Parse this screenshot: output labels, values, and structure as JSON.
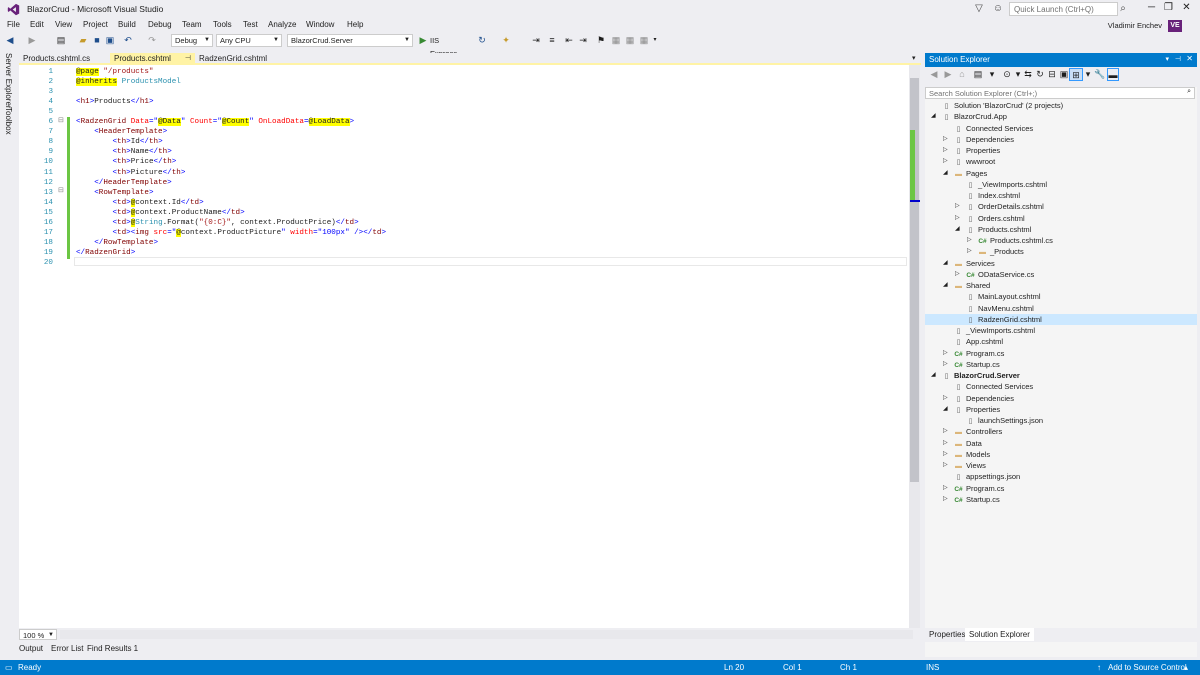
{
  "window": {
    "title": "BlazorCrud - Microsoft Visual Studio",
    "quick_launch_placeholder": "Quick Launch (Ctrl+Q)",
    "user_name": "Vladimir Enchev",
    "user_initials": "VE"
  },
  "menu": [
    "File",
    "Edit",
    "View",
    "Project",
    "Build",
    "Debug",
    "Team",
    "Tools",
    "Test",
    "Analyze",
    "Window",
    "Help"
  ],
  "toolbar": {
    "configuration": "Debug",
    "platform": "Any CPU",
    "startup_project": "BlazorCrud.Server",
    "run_target": "IIS Express"
  },
  "side_strip": [
    "Server Explorer",
    "Toolbox"
  ],
  "doc_tabs": [
    "Products.cshtml.cs",
    "Products.cshtml",
    "RadzenGrid.cshtml"
  ],
  "editor": {
    "zoom": "100 %",
    "lines": [
      [
        {
          "c": "r",
          "t": "@page"
        },
        {
          "c": "n",
          "t": " "
        },
        {
          "c": "s",
          "t": "\"/products\""
        }
      ],
      [
        {
          "c": "r",
          "t": "@inherits"
        },
        {
          "c": "n",
          "t": " "
        },
        {
          "c": "c",
          "t": "ProductsModel"
        }
      ],
      [],
      [
        {
          "c": "k",
          "t": "<"
        },
        {
          "c": "t",
          "t": "h1"
        },
        {
          "c": "k",
          "t": ">"
        },
        {
          "c": "n",
          "t": "Products"
        },
        {
          "c": "k",
          "t": "</"
        },
        {
          "c": "t",
          "t": "h1"
        },
        {
          "c": "k",
          "t": ">"
        }
      ],
      [],
      [
        {
          "c": "k",
          "t": "<"
        },
        {
          "c": "t",
          "t": "RadzenGrid"
        },
        {
          "c": "n",
          "t": " "
        },
        {
          "c": "a",
          "t": "Data"
        },
        {
          "c": "k",
          "t": "=\""
        },
        {
          "c": "r",
          "t": "@Data"
        },
        {
          "c": "k",
          "t": "\""
        },
        {
          "c": "n",
          "t": " "
        },
        {
          "c": "a",
          "t": "Count"
        },
        {
          "c": "k",
          "t": "=\""
        },
        {
          "c": "r",
          "t": "@Count"
        },
        {
          "c": "k",
          "t": "\""
        },
        {
          "c": "n",
          "t": " "
        },
        {
          "c": "a",
          "t": "OnLoadData"
        },
        {
          "c": "k",
          "t": "="
        },
        {
          "c": "r",
          "t": "@LoadData"
        },
        {
          "c": "k",
          "t": ">"
        }
      ],
      [
        {
          "c": "n",
          "t": "    "
        },
        {
          "c": "k",
          "t": "<"
        },
        {
          "c": "t",
          "t": "HeaderTemplate"
        },
        {
          "c": "k",
          "t": ">"
        }
      ],
      [
        {
          "c": "n",
          "t": "        "
        },
        {
          "c": "k",
          "t": "<"
        },
        {
          "c": "t",
          "t": "th"
        },
        {
          "c": "k",
          "t": ">"
        },
        {
          "c": "n",
          "t": "Id"
        },
        {
          "c": "k",
          "t": "</"
        },
        {
          "c": "t",
          "t": "th"
        },
        {
          "c": "k",
          "t": ">"
        }
      ],
      [
        {
          "c": "n",
          "t": "        "
        },
        {
          "c": "k",
          "t": "<"
        },
        {
          "c": "t",
          "t": "th"
        },
        {
          "c": "k",
          "t": ">"
        },
        {
          "c": "n",
          "t": "Name"
        },
        {
          "c": "k",
          "t": "</"
        },
        {
          "c": "t",
          "t": "th"
        },
        {
          "c": "k",
          "t": ">"
        }
      ],
      [
        {
          "c": "n",
          "t": "        "
        },
        {
          "c": "k",
          "t": "<"
        },
        {
          "c": "t",
          "t": "th"
        },
        {
          "c": "k",
          "t": ">"
        },
        {
          "c": "n",
          "t": "Price"
        },
        {
          "c": "k",
          "t": "</"
        },
        {
          "c": "t",
          "t": "th"
        },
        {
          "c": "k",
          "t": ">"
        }
      ],
      [
        {
          "c": "n",
          "t": "        "
        },
        {
          "c": "k",
          "t": "<"
        },
        {
          "c": "t",
          "t": "th"
        },
        {
          "c": "k",
          "t": ">"
        },
        {
          "c": "n",
          "t": "Picture"
        },
        {
          "c": "k",
          "t": "</"
        },
        {
          "c": "t",
          "t": "th"
        },
        {
          "c": "k",
          "t": ">"
        }
      ],
      [
        {
          "c": "n",
          "t": "    "
        },
        {
          "c": "k",
          "t": "</"
        },
        {
          "c": "t",
          "t": "HeaderTemplate"
        },
        {
          "c": "k",
          "t": ">"
        }
      ],
      [
        {
          "c": "n",
          "t": "    "
        },
        {
          "c": "k",
          "t": "<"
        },
        {
          "c": "t",
          "t": "RowTemplate"
        },
        {
          "c": "k",
          "t": ">"
        }
      ],
      [
        {
          "c": "n",
          "t": "        "
        },
        {
          "c": "k",
          "t": "<"
        },
        {
          "c": "t",
          "t": "td"
        },
        {
          "c": "k",
          "t": ">"
        },
        {
          "c": "r",
          "t": "@"
        },
        {
          "c": "n",
          "t": "context.Id"
        },
        {
          "c": "k",
          "t": "</"
        },
        {
          "c": "t",
          "t": "td"
        },
        {
          "c": "k",
          "t": ">"
        }
      ],
      [
        {
          "c": "n",
          "t": "        "
        },
        {
          "c": "k",
          "t": "<"
        },
        {
          "c": "t",
          "t": "td"
        },
        {
          "c": "k",
          "t": ">"
        },
        {
          "c": "r",
          "t": "@"
        },
        {
          "c": "n",
          "t": "context.ProductName"
        },
        {
          "c": "k",
          "t": "</"
        },
        {
          "c": "t",
          "t": "td"
        },
        {
          "c": "k",
          "t": ">"
        }
      ],
      [
        {
          "c": "n",
          "t": "        "
        },
        {
          "c": "k",
          "t": "<"
        },
        {
          "c": "t",
          "t": "td"
        },
        {
          "c": "k",
          "t": ">"
        },
        {
          "c": "r",
          "t": "@"
        },
        {
          "c": "c",
          "t": "String"
        },
        {
          "c": "n",
          "t": ".Format("
        },
        {
          "c": "s",
          "t": "\"{0:C}\""
        },
        {
          "c": "n",
          "t": ", context.ProductPrice)"
        },
        {
          "c": "k",
          "t": "</"
        },
        {
          "c": "t",
          "t": "td"
        },
        {
          "c": "k",
          "t": ">"
        }
      ],
      [
        {
          "c": "n",
          "t": "        "
        },
        {
          "c": "k",
          "t": "<"
        },
        {
          "c": "t",
          "t": "td"
        },
        {
          "c": "k",
          "t": "><"
        },
        {
          "c": "t",
          "t": "img"
        },
        {
          "c": "n",
          "t": " "
        },
        {
          "c": "a",
          "t": "src"
        },
        {
          "c": "k",
          "t": "=\""
        },
        {
          "c": "r",
          "t": "@"
        },
        {
          "c": "n",
          "t": "context.ProductPicture"
        },
        {
          "c": "k",
          "t": "\""
        },
        {
          "c": "n",
          "t": " "
        },
        {
          "c": "a",
          "t": "width"
        },
        {
          "c": "k",
          "t": "=\""
        },
        {
          "c": "k",
          "t": "100px"
        },
        {
          "c": "k",
          "t": "\" /></"
        },
        {
          "c": "t",
          "t": "td"
        },
        {
          "c": "k",
          "t": ">"
        }
      ],
      [
        {
          "c": "n",
          "t": "    "
        },
        {
          "c": "k",
          "t": "</"
        },
        {
          "c": "t",
          "t": "RowTemplate"
        },
        {
          "c": "k",
          "t": ">"
        }
      ],
      [
        {
          "c": "k",
          "t": "</"
        },
        {
          "c": "t",
          "t": "RadzenGrid"
        },
        {
          "c": "k",
          "t": ">"
        }
      ],
      []
    ]
  },
  "bottom_tabs": [
    "Output",
    "Error List",
    "Find Results 1"
  ],
  "status": {
    "state": "Ready",
    "line": "Ln 20",
    "col": "Col 1",
    "ch": "Ch 1",
    "mode": "INS",
    "source_control": "Add to Source Control"
  },
  "solution_explorer": {
    "title": "Solution Explorer",
    "search_placeholder": "Search Solution Explorer (Ctrl+;)",
    "bottom_tabs": [
      "Properties",
      "Solution Explorer"
    ],
    "nodes": [
      {
        "label": "Solution 'BlazorCrud' (2 projects)",
        "depth": 0,
        "arrow": "",
        "icon": "page"
      },
      {
        "label": "BlazorCrud.App",
        "depth": 0,
        "arrow": "open",
        "icon": "page"
      },
      {
        "label": "Connected Services",
        "depth": 1,
        "arrow": "",
        "icon": "page"
      },
      {
        "label": "Dependencies",
        "depth": 1,
        "arrow": "closed",
        "icon": "page"
      },
      {
        "label": "Properties",
        "depth": 1,
        "arrow": "closed",
        "icon": "page"
      },
      {
        "label": "wwwroot",
        "depth": 1,
        "arrow": "closed",
        "icon": "page"
      },
      {
        "label": "Pages",
        "depth": 1,
        "arrow": "open",
        "icon": "folder"
      },
      {
        "label": "_ViewImports.cshtml",
        "depth": 2,
        "arrow": "",
        "icon": "page"
      },
      {
        "label": "Index.cshtml",
        "depth": 2,
        "arrow": "",
        "icon": "page"
      },
      {
        "label": "OrderDetails.cshtml",
        "depth": 2,
        "arrow": "closed",
        "icon": "page"
      },
      {
        "label": "Orders.cshtml",
        "depth": 2,
        "arrow": "closed",
        "icon": "page"
      },
      {
        "label": "Products.cshtml",
        "depth": 2,
        "arrow": "open",
        "icon": "page"
      },
      {
        "label": "Products.cshtml.cs",
        "depth": 3,
        "arrow": "closed",
        "icon": "cs"
      },
      {
        "label": "_Products",
        "depth": 3,
        "arrow": "closed",
        "icon": "folder"
      },
      {
        "label": "Services",
        "depth": 1,
        "arrow": "open",
        "icon": "folder"
      },
      {
        "label": "ODataService.cs",
        "depth": 2,
        "arrow": "closed",
        "icon": "cs"
      },
      {
        "label": "Shared",
        "depth": 1,
        "arrow": "open",
        "icon": "folder"
      },
      {
        "label": "MainLayout.cshtml",
        "depth": 2,
        "arrow": "",
        "icon": "page"
      },
      {
        "label": "NavMenu.cshtml",
        "depth": 2,
        "arrow": "",
        "icon": "page"
      },
      {
        "label": "RadzenGrid.cshtml",
        "depth": 2,
        "arrow": "",
        "icon": "page",
        "selected": true
      },
      {
        "label": "_ViewImports.cshtml",
        "depth": 1,
        "arrow": "",
        "icon": "page"
      },
      {
        "label": "App.cshtml",
        "depth": 1,
        "arrow": "",
        "icon": "page"
      },
      {
        "label": "Program.cs",
        "depth": 1,
        "arrow": "closed",
        "icon": "cs"
      },
      {
        "label": "Startup.cs",
        "depth": 1,
        "arrow": "closed",
        "icon": "cs"
      },
      {
        "label": "BlazorCrud.Server",
        "depth": 0,
        "arrow": "open",
        "icon": "page",
        "bold": true
      },
      {
        "label": "Connected Services",
        "depth": 1,
        "arrow": "",
        "icon": "page"
      },
      {
        "label": "Dependencies",
        "depth": 1,
        "arrow": "closed",
        "icon": "page"
      },
      {
        "label": "Properties",
        "depth": 1,
        "arrow": "open",
        "icon": "page"
      },
      {
        "label": "launchSettings.json",
        "depth": 2,
        "arrow": "",
        "icon": "page"
      },
      {
        "label": "Controllers",
        "depth": 1,
        "arrow": "closed",
        "icon": "folder"
      },
      {
        "label": "Data",
        "depth": 1,
        "arrow": "closed",
        "icon": "folder"
      },
      {
        "label": "Models",
        "depth": 1,
        "arrow": "closed",
        "icon": "folder"
      },
      {
        "label": "Views",
        "depth": 1,
        "arrow": "closed",
        "icon": "folder"
      },
      {
        "label": "appsettings.json",
        "depth": 1,
        "arrow": "",
        "icon": "page"
      },
      {
        "label": "Program.cs",
        "depth": 1,
        "arrow": "closed",
        "icon": "cs"
      },
      {
        "label": "Startup.cs",
        "depth": 1,
        "arrow": "closed",
        "icon": "cs"
      }
    ]
  }
}
